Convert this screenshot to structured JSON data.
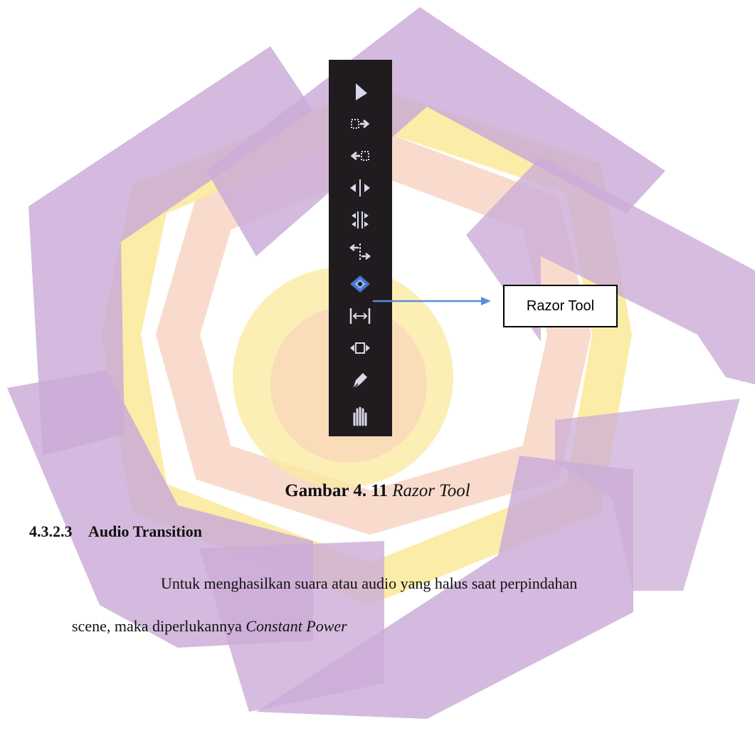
{
  "toolbar": {
    "tools": [
      {
        "icon": "selection-arrow-icon"
      },
      {
        "icon": "track-select-forward-icon"
      },
      {
        "icon": "track-select-backward-icon"
      },
      {
        "icon": "ripple-edit-icon"
      },
      {
        "icon": "rolling-edit-icon"
      },
      {
        "icon": "rate-stretch-icon"
      },
      {
        "icon": "razor-icon"
      },
      {
        "icon": "slip-icon"
      },
      {
        "icon": "slide-icon"
      },
      {
        "icon": "pen-icon"
      },
      {
        "icon": "hand-icon"
      }
    ]
  },
  "callout": {
    "label": "Razor Tool"
  },
  "caption": {
    "prefix": "Gambar 4. 11",
    "title": "Razor Tool"
  },
  "section": {
    "number": "4.3.2.3",
    "title": "Audio Transition"
  },
  "paragraph": {
    "line1": "Untuk menghasilkan suara atau audio yang halus saat perpindahan",
    "line2": "scene, maka diperlukannya",
    "term": "Constant Power"
  },
  "colors": {
    "watermark_purple": "#c9a9d6",
    "watermark_yellow": "#fbe99a",
    "watermark_peach": "#f7c9b4",
    "toolbar_bg": "#1f1b1f",
    "icon": "#d8d8e8",
    "razor_icon": "#4a74c9",
    "arrow": "#5b8fd6"
  }
}
